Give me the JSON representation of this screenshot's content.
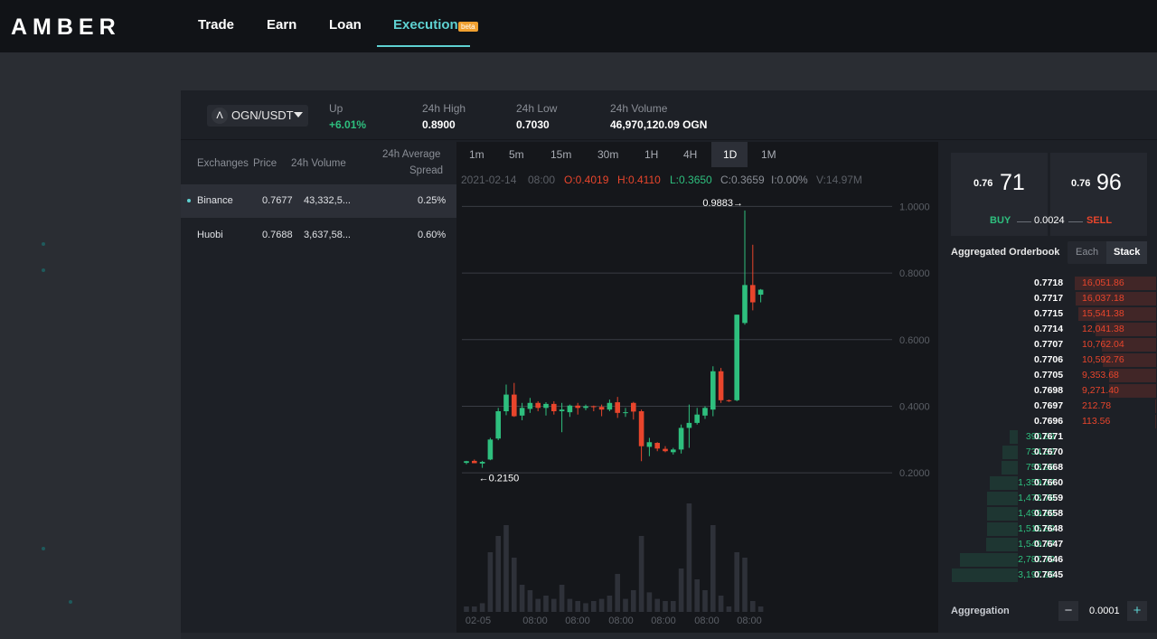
{
  "nav": {
    "logo": "AMBER",
    "items": [
      {
        "label": "Trade"
      },
      {
        "label": "Earn"
      },
      {
        "label": "Loan"
      },
      {
        "label": "Execution",
        "badge": "beta"
      }
    ],
    "active": "Execution",
    "accent_color": "#5ed1d1"
  },
  "ticker": {
    "pair": "OGN/USDT",
    "pair_icon": "amber-chevron-icon",
    "stats": [
      {
        "label": "Up",
        "value": "+6.01%",
        "color": "#2ebf7e"
      },
      {
        "label": "24h High",
        "value": "0.8900"
      },
      {
        "label": "24h Low",
        "value": "0.7030"
      },
      {
        "label": "24h Volume",
        "value": "46,970,120.09 OGN"
      }
    ]
  },
  "exchanges": {
    "headers": [
      "Exchanges",
      "Price",
      "24h Volume",
      "24h Average",
      "Spread"
    ],
    "rows": [
      {
        "name": "Binance",
        "price": "0.7677",
        "volume": "43,332,5...",
        "spread": "0.25%",
        "selected": true
      },
      {
        "name": "Huobi",
        "price": "0.7688",
        "volume": "3,637,58...",
        "spread": "0.60%",
        "selected": false
      }
    ]
  },
  "chart": {
    "timeframes": [
      "1m",
      "5m",
      "15m",
      "30m",
      "1H",
      "4H",
      "1D",
      "1M"
    ],
    "active_timeframe": "1D",
    "ohlc_line": {
      "date": "2021-02-14",
      "time": "08:00",
      "open": "O:0.4019",
      "high": "H:0.4110",
      "low": "L:0.3650",
      "close": "C:0.3659",
      "change": "I:0.00%",
      "volume": "V:14.97M"
    },
    "max_label": "0.9883→",
    "min_label": "←0.2150",
    "x_labels": [
      "02-05",
      "08:00",
      "08:00",
      "08:00",
      "08:00",
      "08:00",
      "08:00",
      "08:00"
    ]
  },
  "chart_data": {
    "type": "candlestick",
    "ylim": [
      0.1,
      1.05
    ],
    "yticks": [
      "1.0000",
      "0.8000",
      "0.6000",
      "0.4000",
      "0.2000"
    ],
    "ytick_values": [
      1.0,
      0.8,
      0.6,
      0.4,
      0.2
    ],
    "grid": true,
    "up_color": "#2ebf7e",
    "down_color": "#e8452c",
    "candles": [
      {
        "o": 0.23,
        "h": 0.236,
        "l": 0.226,
        "c": 0.235
      },
      {
        "o": 0.236,
        "h": 0.24,
        "l": 0.229,
        "c": 0.229
      },
      {
        "o": 0.228,
        "h": 0.236,
        "l": 0.215,
        "c": 0.233
      },
      {
        "o": 0.24,
        "h": 0.305,
        "l": 0.238,
        "c": 0.3
      },
      {
        "o": 0.303,
        "h": 0.395,
        "l": 0.298,
        "c": 0.385
      },
      {
        "o": 0.385,
        "h": 0.465,
        "l": 0.373,
        "c": 0.435
      },
      {
        "o": 0.435,
        "h": 0.47,
        "l": 0.368,
        "c": 0.37
      },
      {
        "o": 0.372,
        "h": 0.41,
        "l": 0.358,
        "c": 0.395
      },
      {
        "o": 0.392,
        "h": 0.425,
        "l": 0.38,
        "c": 0.41
      },
      {
        "o": 0.41,
        "h": 0.415,
        "l": 0.385,
        "c": 0.395
      },
      {
        "o": 0.395,
        "h": 0.412,
        "l": 0.372,
        "c": 0.407
      },
      {
        "o": 0.407,
        "h": 0.415,
        "l": 0.375,
        "c": 0.385
      },
      {
        "o": 0.385,
        "h": 0.41,
        "l": 0.322,
        "c": 0.39
      },
      {
        "o": 0.382,
        "h": 0.405,
        "l": 0.368,
        "c": 0.402
      },
      {
        "o": 0.402,
        "h": 0.41,
        "l": 0.375,
        "c": 0.395
      },
      {
        "o": 0.395,
        "h": 0.405,
        "l": 0.388,
        "c": 0.4
      },
      {
        "o": 0.4,
        "h": 0.402,
        "l": 0.385,
        "c": 0.398
      },
      {
        "o": 0.398,
        "h": 0.405,
        "l": 0.37,
        "c": 0.39
      },
      {
        "o": 0.39,
        "h": 0.42,
        "l": 0.385,
        "c": 0.41
      },
      {
        "o": 0.412,
        "h": 0.428,
        "l": 0.365,
        "c": 0.38
      },
      {
        "o": 0.38,
        "h": 0.395,
        "l": 0.368,
        "c": 0.382
      },
      {
        "o": 0.41,
        "h": 0.413,
        "l": 0.36,
        "c": 0.384
      },
      {
        "o": 0.385,
        "h": 0.39,
        "l": 0.235,
        "c": 0.28
      },
      {
        "o": 0.278,
        "h": 0.305,
        "l": 0.25,
        "c": 0.292
      },
      {
        "o": 0.29,
        "h": 0.292,
        "l": 0.265,
        "c": 0.273
      },
      {
        "o": 0.272,
        "h": 0.28,
        "l": 0.262,
        "c": 0.265
      },
      {
        "o": 0.262,
        "h": 0.275,
        "l": 0.255,
        "c": 0.27
      },
      {
        "o": 0.27,
        "h": 0.345,
        "l": 0.258,
        "c": 0.335
      },
      {
        "o": 0.335,
        "h": 0.405,
        "l": 0.275,
        "c": 0.35
      },
      {
        "o": 0.35,
        "h": 0.395,
        "l": 0.345,
        "c": 0.375
      },
      {
        "o": 0.372,
        "h": 0.4,
        "l": 0.362,
        "c": 0.395
      },
      {
        "o": 0.39,
        "h": 0.52,
        "l": 0.37,
        "c": 0.505
      },
      {
        "o": 0.505,
        "h": 0.515,
        "l": 0.41,
        "c": 0.418
      },
      {
        "o": 0.418,
        "h": 0.42,
        "l": 0.413,
        "c": 0.417
      },
      {
        "o": 0.418,
        "h": 0.675,
        "l": 0.415,
        "c": 0.675
      },
      {
        "o": 0.65,
        "h": 0.988,
        "l": 0.645,
        "c": 0.764
      },
      {
        "o": 0.764,
        "h": 0.885,
        "l": 0.688,
        "c": 0.712
      },
      {
        "o": 0.735,
        "h": 0.752,
        "l": 0.712,
        "c": 0.75
      }
    ],
    "volume_relative": [
      0.05,
      0.05,
      0.08,
      0.55,
      0.7,
      0.8,
      0.5,
      0.25,
      0.2,
      0.12,
      0.15,
      0.12,
      0.25,
      0.12,
      0.1,
      0.08,
      0.1,
      0.12,
      0.15,
      0.35,
      0.12,
      0.2,
      0.7,
      0.18,
      0.12,
      0.1,
      0.1,
      0.4,
      1.0,
      0.3,
      0.2,
      0.8,
      0.15,
      0.05,
      0.55,
      0.5,
      0.1,
      0.05
    ]
  },
  "orderbook": {
    "best_buy": {
      "small": "0.76",
      "big": "71"
    },
    "best_sell": {
      "small": "0.76",
      "big": "96"
    },
    "buy_label": "BUY",
    "sell_label": "SELL",
    "spread": "0.0024",
    "title": "Aggregated Orderbook",
    "tabs": [
      "Each",
      "Stack"
    ],
    "active_tab": "Stack",
    "asks": [
      {
        "price": "0.7718",
        "qty": "16,051.86",
        "depth": 1.0
      },
      {
        "price": "0.7717",
        "qty": "16,037.18",
        "depth": 0.99
      },
      {
        "price": "0.7715",
        "qty": "15,541.38",
        "depth": 0.96
      },
      {
        "price": "0.7714",
        "qty": "12,041.38",
        "depth": 0.75
      },
      {
        "price": "0.7707",
        "qty": "10,762.04",
        "depth": 0.67
      },
      {
        "price": "0.7706",
        "qty": "10,592.76",
        "depth": 0.66
      },
      {
        "price": "0.7705",
        "qty": "9,353.68",
        "depth": 0.58
      },
      {
        "price": "0.7698",
        "qty": "9,271.40",
        "depth": 0.58
      },
      {
        "price": "0.7697",
        "qty": "212.78",
        "depth": 0.01
      },
      {
        "price": "0.7696",
        "qty": "113.56",
        "depth": 0.01
      }
    ],
    "bids": [
      {
        "price": "0.7671",
        "qty": "390.83",
        "depth": 0.12
      },
      {
        "price": "0.7670",
        "qty": "734.32",
        "depth": 0.23
      },
      {
        "price": "0.7668",
        "qty": "753.96",
        "depth": 0.24
      },
      {
        "price": "0.7660",
        "qty": "1,359.67",
        "depth": 0.43
      },
      {
        "price": "0.7659",
        "qty": "1,473.78",
        "depth": 0.46
      },
      {
        "price": "0.7658",
        "qty": "1,499.89",
        "depth": 0.47
      },
      {
        "price": "0.7648",
        "qty": "1,515.89",
        "depth": 0.47
      },
      {
        "price": "0.7647",
        "qty": "1,549.77",
        "depth": 0.48
      },
      {
        "price": "0.7646",
        "qty": "2,787.79",
        "depth": 0.87
      },
      {
        "price": "0.7645",
        "qty": "3,197.95",
        "depth": 1.0
      }
    ],
    "aggregation_label": "Aggregation",
    "aggregation_value": "0.0001"
  }
}
